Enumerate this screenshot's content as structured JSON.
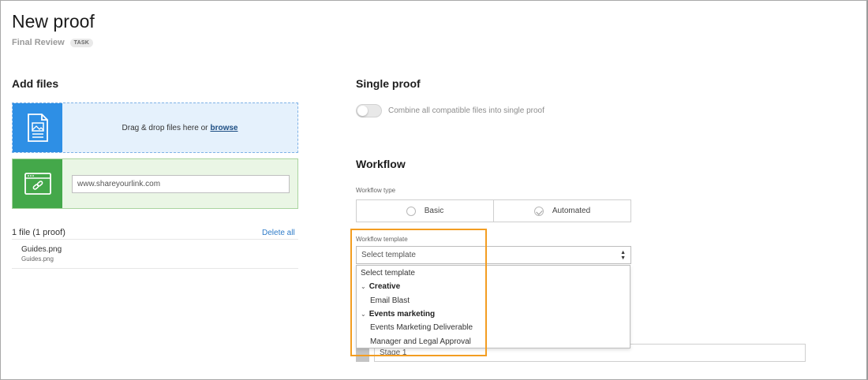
{
  "header": {
    "title": "New proof",
    "subtitle": "Final Review",
    "badge": "TASK"
  },
  "add_files": {
    "heading": "Add files",
    "drop_text": "Drag & drop files here or",
    "browse_label": "browse",
    "url_value": "www.shareyourlink.com",
    "drop_icon": "file-image-icon",
    "link_icon": "browser-link-icon",
    "drop_color": "#2e8fe5",
    "link_color": "#44a84a"
  },
  "files": {
    "count_label": "1 file (1 proof)",
    "delete_all_label": "Delete all",
    "items": [
      {
        "name": "Guides.png",
        "sub": "Guides.png"
      }
    ]
  },
  "single_proof": {
    "heading": "Single proof",
    "toggle_label": "Combine all compatible files into single proof",
    "enabled": false
  },
  "workflow": {
    "heading": "Workflow",
    "type_label": "Workflow type",
    "types": [
      {
        "label": "Basic",
        "selected": false
      },
      {
        "label": "Automated",
        "selected": true
      }
    ],
    "template_label": "Workflow template",
    "template_value": "Select template",
    "options": [
      {
        "label": "Select template",
        "kind": "option"
      },
      {
        "label": "Creative",
        "kind": "group"
      },
      {
        "label": "Email Blast",
        "kind": "option"
      },
      {
        "label": "Events marketing",
        "kind": "group"
      },
      {
        "label": "Events Marketing Deliverable",
        "kind": "option"
      },
      {
        "label": "Manager and Legal Approval",
        "kind": "option"
      }
    ],
    "stage_value": "Stage 1",
    "highlight_color": "#f39d21"
  }
}
